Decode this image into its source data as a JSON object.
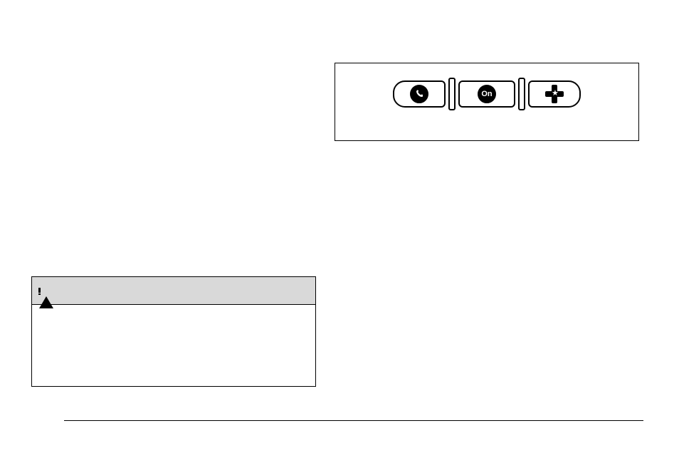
{
  "figure": {
    "buttons": {
      "phone_label": "phone",
      "onstar_label": "On",
      "emergency_label": "emergency"
    }
  },
  "caution": {
    "header_icon": "warning",
    "body_text": ""
  }
}
